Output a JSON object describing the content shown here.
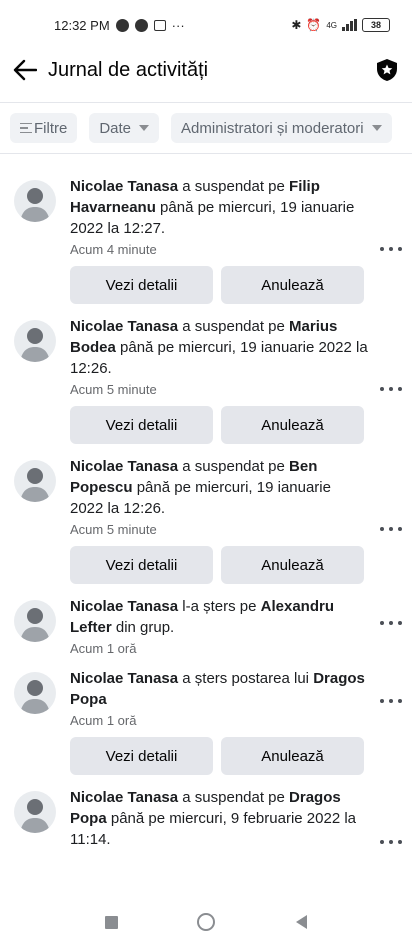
{
  "status_bar": {
    "time": "12:32 PM",
    "dots": "···",
    "battery": "38",
    "network": "4G"
  },
  "header": {
    "title": "Jurnal de activități"
  },
  "filters": [
    {
      "label": "Filtre"
    },
    {
      "label": "Date"
    },
    {
      "label": "Administratori și moderatori"
    }
  ],
  "entries": [
    {
      "actor": "Nicolae Tanasa",
      "verb": " a suspendat pe ",
      "target": "Filip Havarneanu",
      "tail": " până pe miercuri, 19 ianuarie 2022 la 12:27.",
      "time": "Acum 4 minute",
      "details_label": "Vezi detalii",
      "undo_label": "Anulează"
    },
    {
      "actor": "Nicolae Tanasa",
      "verb": " a suspendat pe ",
      "target": "Marius Bodea",
      "tail": " până pe miercuri, 19 ianuarie 2022 la 12:26.",
      "time": "Acum 5 minute",
      "details_label": "Vezi detalii",
      "undo_label": "Anulează"
    },
    {
      "actor": "Nicolae Tanasa",
      "verb": " a suspendat pe ",
      "target": "Ben Popescu",
      "tail": " până pe miercuri, 19 ianuarie 2022 la 12:26.",
      "time": "Acum 5 minute",
      "details_label": "Vezi detalii",
      "undo_label": "Anulează"
    },
    {
      "actor": "Nicolae Tanasa",
      "verb": " l-a șters pe ",
      "target": "Alexandru Lefter",
      "tail": " din grup.",
      "time": "Acum 1 oră"
    },
    {
      "actor": "Nicolae Tanasa",
      "verb": " a șters postarea lui ",
      "target": "Dragos Popa",
      "tail": "",
      "time": "Acum 1 oră",
      "details_label": "Vezi detalii",
      "undo_label": "Anulează"
    },
    {
      "actor": "Nicolae Tanasa",
      "verb": " a suspendat pe ",
      "target": "Dragos Popa",
      "tail": " până pe miercuri, 9 februarie 2022 la 11:14.",
      "time": ""
    }
  ],
  "colors": {
    "button_bg": "#e4e6eb",
    "chip_bg": "#f0f2f5",
    "muted_text": "#65676b"
  }
}
